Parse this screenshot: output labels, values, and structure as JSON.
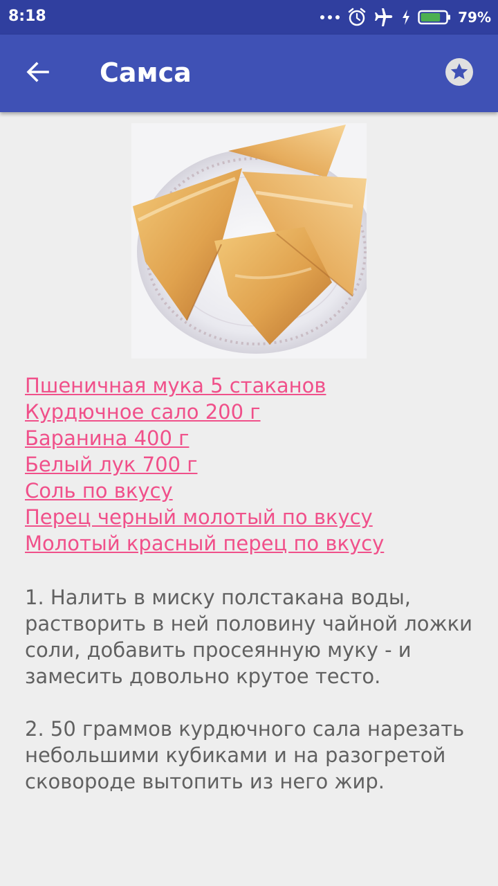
{
  "status_bar": {
    "time": "8:18",
    "battery_percent": "79%",
    "battery_level": 0.79,
    "icons": [
      "more-dots-icon",
      "alarm-icon",
      "airplane-mode-icon",
      "charging-icon",
      "battery-icon"
    ]
  },
  "app_bar": {
    "title": "Самса",
    "back_icon": "arrow-back-icon",
    "favorite_icon": "star-icon"
  },
  "recipe": {
    "photo_alt": "samsa-photo",
    "ingredients": [
      "Пшеничная мука 5 стаканов",
      "Курдючное сало 200 г",
      "Баранина 400 г",
      "Белый лук 700 г",
      "Соль по вкусу",
      "Перец черный молотый по вкусу",
      "Молотый красный перец по вкусу"
    ],
    "steps": [
      "1. Налить в миску полстакана воды, растворить в ней половину чайной ложки соли, добавить просеянную муку - и замесить довольно крутое тесто.",
      "2. 50 граммов курдючного сала нарезать небольшими кубиками и на разогретой сковороде вытопить из него жир."
    ]
  },
  "colors": {
    "status_bar": "#303f9f",
    "app_bar": "#3f51b5",
    "link": "#f0508a",
    "body_text": "#616161",
    "background": "#eeeeee",
    "battery_fill": "#4caf50"
  }
}
